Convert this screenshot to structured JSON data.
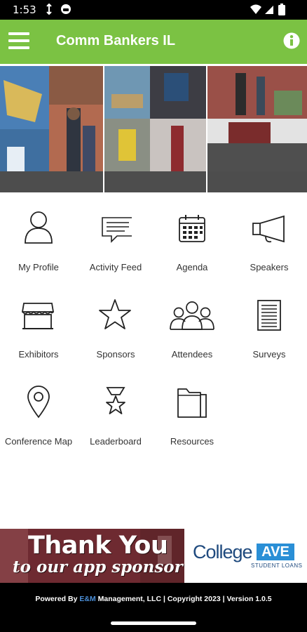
{
  "status": {
    "time": "1:53"
  },
  "header": {
    "title": "Comm Bankers IL",
    "menu_icon": "hamburger-menu-icon",
    "info_icon": "info-icon"
  },
  "colors": {
    "app_bar": "#7bc243",
    "footer": "#000000",
    "sponsor_banner": "#7a3138",
    "sponsor_brand": "#1f4a7e",
    "sponsor_accent": "#2a8fd6"
  },
  "menu": [
    {
      "label": "My Profile",
      "icon": "person-icon"
    },
    {
      "label": "Activity Feed",
      "icon": "chat-bubble-icon"
    },
    {
      "label": "Agenda",
      "icon": "calendar-icon"
    },
    {
      "label": "Speakers",
      "icon": "megaphone-icon"
    },
    {
      "label": "Exhibitors",
      "icon": "storefront-icon"
    },
    {
      "label": "Sponsors",
      "icon": "star-icon"
    },
    {
      "label": "Attendees",
      "icon": "group-icon"
    },
    {
      "label": "Surveys",
      "icon": "document-icon"
    },
    {
      "label": "Conference Map",
      "icon": "map-pin-icon"
    },
    {
      "label": "Leaderboard",
      "icon": "medal-icon"
    },
    {
      "label": "Resources",
      "icon": "folder-icon"
    }
  ],
  "sponsor": {
    "line1": "Thank You",
    "line2": "to our app sponsor",
    "brand_text": "College",
    "brand_badge": "AVE",
    "brand_sub": "STUDENT LOANS"
  },
  "footer": {
    "prefix": "Powered By ",
    "company_em": "E&M",
    "rest": " Management, LLC | Copyright 2023 | Version 1.0.5"
  }
}
